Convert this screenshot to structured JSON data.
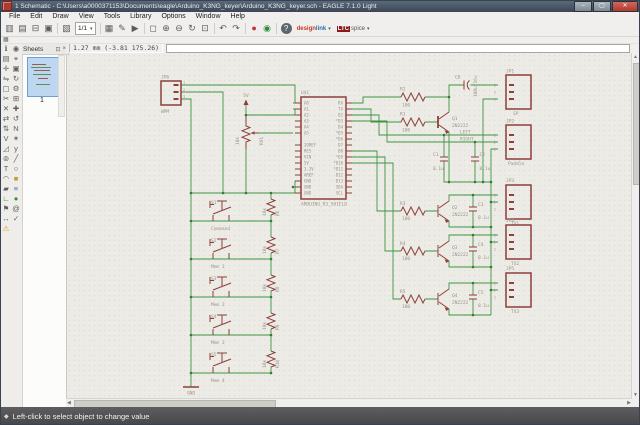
{
  "window": {
    "title": "1 Schematic - C:\\Users\\a0000371153\\Documents\\eagle\\Arduino_K3NG_keyer\\Arduino_K3NG_keyer.sch - EAGLE 7.1.0 Light",
    "controls": {
      "minimize": "–",
      "maximize": "▢",
      "close": "✕"
    }
  },
  "menu": [
    "File",
    "Edit",
    "Draw",
    "View",
    "Tools",
    "Library",
    "Options",
    "Window",
    "Help"
  ],
  "toolbar": {
    "sheet_selector": "1/1",
    "dropdown_arrow": "▾"
  },
  "icons": {
    "top": [
      {
        "name": "open-icon",
        "glyph": "▥"
      },
      {
        "name": "save-icon",
        "glyph": "▤"
      },
      {
        "name": "print-icon",
        "glyph": "⊟"
      },
      {
        "name": "cam-processor-icon",
        "glyph": "▣"
      },
      {
        "sep": true
      },
      {
        "name": "switch-to-board-icon",
        "glyph": "▧"
      },
      {
        "type": "sheet-dropdown",
        "name": "sheet-selector"
      },
      {
        "sep": true
      },
      {
        "name": "use-library-icon",
        "glyph": "▦"
      },
      {
        "name": "script-icon",
        "glyph": "✎"
      },
      {
        "name": "run-ulp-icon",
        "glyph": "▶"
      },
      {
        "sep": true
      },
      {
        "name": "zoom-fit-icon",
        "glyph": "◻"
      },
      {
        "name": "zoom-in-icon",
        "glyph": "⊕"
      },
      {
        "name": "zoom-out-icon",
        "glyph": "⊖"
      },
      {
        "name": "zoom-redraw-icon",
        "glyph": "↻"
      },
      {
        "name": "zoom-select-icon",
        "glyph": "⊡"
      },
      {
        "sep": true
      },
      {
        "name": "undo-icon",
        "glyph": "↶"
      },
      {
        "name": "redo-icon",
        "glyph": "↷"
      },
      {
        "sep": true
      },
      {
        "name": "stop-icon",
        "glyph": "●"
      },
      {
        "name": "go-icon",
        "glyph": "◉"
      },
      {
        "sep": true
      },
      {
        "name": "help-icon",
        "glyph": "?"
      },
      {
        "type": "logo",
        "name": "designlink-button",
        "red": "design",
        "blue": "link",
        "arrow": "▾"
      },
      {
        "type": "logo2",
        "name": "ltspice-button",
        "box": "LTC",
        "rest": "spice",
        "arrow": "▾"
      }
    ],
    "mini": [
      {
        "name": "grid-icon",
        "glyph": "▦"
      }
    ],
    "left": [
      {
        "name": "info-icon",
        "glyph": "ℹ"
      },
      {
        "name": "show-icon",
        "glyph": "◉"
      },
      {
        "name": "display-icon",
        "glyph": "▤"
      },
      {
        "name": "mark-icon",
        "glyph": "⌖"
      },
      {
        "name": "move-icon",
        "glyph": "✛"
      },
      {
        "name": "copy-icon",
        "glyph": "▣"
      },
      {
        "name": "mirror-icon",
        "glyph": "⇋"
      },
      {
        "name": "rotate-icon",
        "glyph": "↻"
      },
      {
        "name": "group-icon",
        "glyph": "▢"
      },
      {
        "name": "change-icon",
        "glyph": "⚙"
      },
      {
        "name": "cut-icon",
        "glyph": "✂"
      },
      {
        "name": "paste-icon",
        "glyph": "⊞"
      },
      {
        "name": "delete-icon",
        "glyph": "✕"
      },
      {
        "name": "add-icon",
        "glyph": "✚"
      },
      {
        "name": "pinswap-icon",
        "glyph": "⇄"
      },
      {
        "name": "replace-icon",
        "glyph": "↺"
      },
      {
        "name": "gateswap-icon",
        "glyph": "⇅"
      },
      {
        "name": "name-icon",
        "glyph": "N"
      },
      {
        "name": "value-icon",
        "glyph": "V"
      },
      {
        "name": "smash-icon",
        "glyph": "✶"
      },
      {
        "name": "miter-icon",
        "glyph": "◿"
      },
      {
        "name": "split-icon",
        "glyph": "y"
      },
      {
        "name": "invoke-icon",
        "glyph": "⊚"
      },
      {
        "name": "wire-icon",
        "glyph": "╱"
      },
      {
        "name": "text-icon",
        "glyph": "T"
      },
      {
        "name": "circle-icon",
        "glyph": "○"
      },
      {
        "name": "arc-icon",
        "glyph": "◠"
      },
      {
        "name": "rect-icon",
        "glyph": "■"
      },
      {
        "name": "polygon-icon",
        "glyph": "▰"
      },
      {
        "name": "bus-icon",
        "glyph": "≡"
      },
      {
        "name": "net-icon",
        "glyph": "∟"
      },
      {
        "name": "junction-icon",
        "glyph": "●"
      },
      {
        "name": "label-icon",
        "glyph": "⚑"
      },
      {
        "name": "attribute-icon",
        "glyph": "@"
      },
      {
        "name": "dimension-icon",
        "glyph": "↔"
      },
      {
        "name": "erc-icon",
        "glyph": "✓"
      },
      {
        "name": "errors-icon",
        "glyph": "⚠"
      }
    ],
    "sheets_pin": "⊡",
    "sheets_close": "×",
    "status": "◆",
    "scroll_up": "▲",
    "scroll_down": "▼",
    "scroll_left": "◀",
    "scroll_right": "▶"
  },
  "panels": {
    "sheets": {
      "title": "Sheets",
      "sheet_number": "1"
    }
  },
  "command_bar": {
    "coordinates": "1.27 mm (-3.81 175.26)",
    "command_value": ""
  },
  "statusbar": {
    "message": "Left-click to select object to change value"
  },
  "schematic": {
    "supply_5v": "5V",
    "gnd": "GND",
    "jp6": {
      "name": "JP6",
      "value": "WPM",
      "pins": [
        "1",
        "2",
        "3"
      ]
    },
    "pot": {
      "name": "RV1",
      "value": "10k"
    },
    "ic": {
      "name": "U$1",
      "value": "ARDUINO_R3_SHIELD",
      "left_pins": [
        "A0",
        "A1",
        "A2",
        "A3",
        "A4",
        "A5",
        "IOREF",
        "RES",
        "VIN",
        "5V",
        "3.3V",
        "AREF",
        "GND",
        "GND",
        "GND"
      ],
      "right_pins": [
        "RX",
        "TX",
        "D2",
        "*D3",
        "D4",
        "*D5",
        "*D6",
        "D7",
        "D8",
        "*D9",
        "*D10",
        "*D11",
        "D12",
        "D13",
        "SDA",
        "SCL"
      ]
    },
    "buttons": [
      {
        "name": "S1",
        "value": "Command",
        "resistor": "R6",
        "resistor_value": "10k"
      },
      {
        "name": "S2",
        "value": "Mem 1",
        "resistor": "R7",
        "resistor_value": "10k"
      },
      {
        "name": "S3",
        "value": "Mem 2",
        "resistor": "R8",
        "resistor_value": "10k"
      },
      {
        "name": "S4",
        "value": "Mem 3",
        "resistor": "R9",
        "resistor_value": "10k"
      },
      {
        "name": "S5",
        "value": "Mem 4",
        "resistor": "R10",
        "resistor_value": "10k"
      }
    ],
    "sidetone": {
      "r_top": {
        "name": "R2",
        "value": "100"
      },
      "r_base": {
        "name": "R1",
        "value": "100"
      },
      "q": {
        "name": "Q1",
        "value": "2N2222"
      },
      "cap": {
        "name": "C6",
        "value": "100u/16v"
      },
      "jp": {
        "name": "JP1",
        "value": "SP",
        "pins": [
          "3",
          "2",
          "1"
        ]
      }
    },
    "paddle": {
      "jp": {
        "name": "JP2",
        "value": "Paddle",
        "pins": [
          "3",
          "2",
          "1"
        ]
      },
      "net_left": "LEFT",
      "net_right": "RIGHT",
      "cap1": {
        "name": "C1",
        "value": "0.1u"
      },
      "cap2": {
        "name": "C2",
        "value": "0.1u"
      }
    },
    "tx_rows": [
      {
        "r": {
          "name": "R3",
          "value": "100"
        },
        "q": {
          "name": "Q2",
          "value": "2N2222"
        },
        "cap": {
          "name": "C3",
          "value": "0.1u"
        },
        "jp": {
          "name": "JP3",
          "value": "TX1",
          "pins": [
            "3",
            "2",
            "1"
          ]
        }
      },
      {
        "r": {
          "name": "R4",
          "value": "100"
        },
        "q": {
          "name": "Q3",
          "value": "2N2222"
        },
        "cap": {
          "name": "C4",
          "value": "0.1u"
        },
        "jp": {
          "name": "JP4",
          "value": "TX2",
          "pins": [
            "3",
            "2",
            "1"
          ]
        }
      },
      {
        "r": {
          "name": "R5",
          "value": "100"
        },
        "q": {
          "name": "Q4",
          "value": "2N2222"
        },
        "cap": {
          "name": "C5",
          "value": "0.1u"
        },
        "jp": {
          "name": "JP5",
          "value": "TX3",
          "pins": [
            "3",
            "2",
            "1"
          ]
        }
      }
    ]
  }
}
